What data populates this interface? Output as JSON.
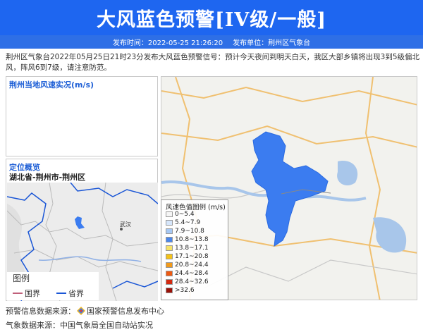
{
  "header": {
    "title": "大风蓝色预警[IV级/一般]",
    "publish_time_label": "发布时间：",
    "publish_time": "2022-05-25 21:26:20",
    "publish_unit_label": "发布单位：",
    "publish_unit": "荆州区气象台"
  },
  "description": "荆州区气象台2022年05月25日21时23分发布大风蓝色预警信号：预计今天夜间到明天白天，我区大部乡镇将出现3到5级偏北风，阵风6到7级，请注意防范。",
  "wind_panel": {
    "title": "荆州当地风速实况(m/s)"
  },
  "location_panel": {
    "title": "定位概览",
    "region": "湖北省-荆州市-荆州区",
    "city_label": "武汉",
    "legend": {
      "title": "图例",
      "items": [
        {
          "label": "国界",
          "color": "#c0607a"
        },
        {
          "label": "省界",
          "color": "#1a56d6"
        }
      ]
    }
  },
  "wind_legend": {
    "title": "风速色值图例 (m/s)",
    "items": [
      {
        "label": "0~5.4",
        "color": "#f5f5f5"
      },
      {
        "label": "5.4~7.9",
        "color": "#d6e6fb"
      },
      {
        "label": "7.9~10.8",
        "color": "#a6c8f4"
      },
      {
        "label": "10.8~13.8",
        "color": "#4a86ea"
      },
      {
        "label": "13.8~17.1",
        "color": "#f7e36a"
      },
      {
        "label": "17.1~20.8",
        "color": "#f4c218"
      },
      {
        "label": "20.8~24.4",
        "color": "#f29a1a"
      },
      {
        "label": "24.4~28.4",
        "color": "#ee5a12"
      },
      {
        "label": "28.4~32.6",
        "color": "#d42a10"
      },
      {
        "label": ">32.6",
        "color": "#9a1208"
      }
    ]
  },
  "footer": {
    "source1_label": "预警信息数据来源：",
    "source1_value": "国家预警信息发布中心",
    "source2_label": "气象数据来源：",
    "source2_value": "中国气象局全国自动站实况"
  },
  "colors": {
    "header_bg": "#1e66f0",
    "panel_title": "#1e5fd6",
    "region_fill": "#3b7cf0"
  }
}
